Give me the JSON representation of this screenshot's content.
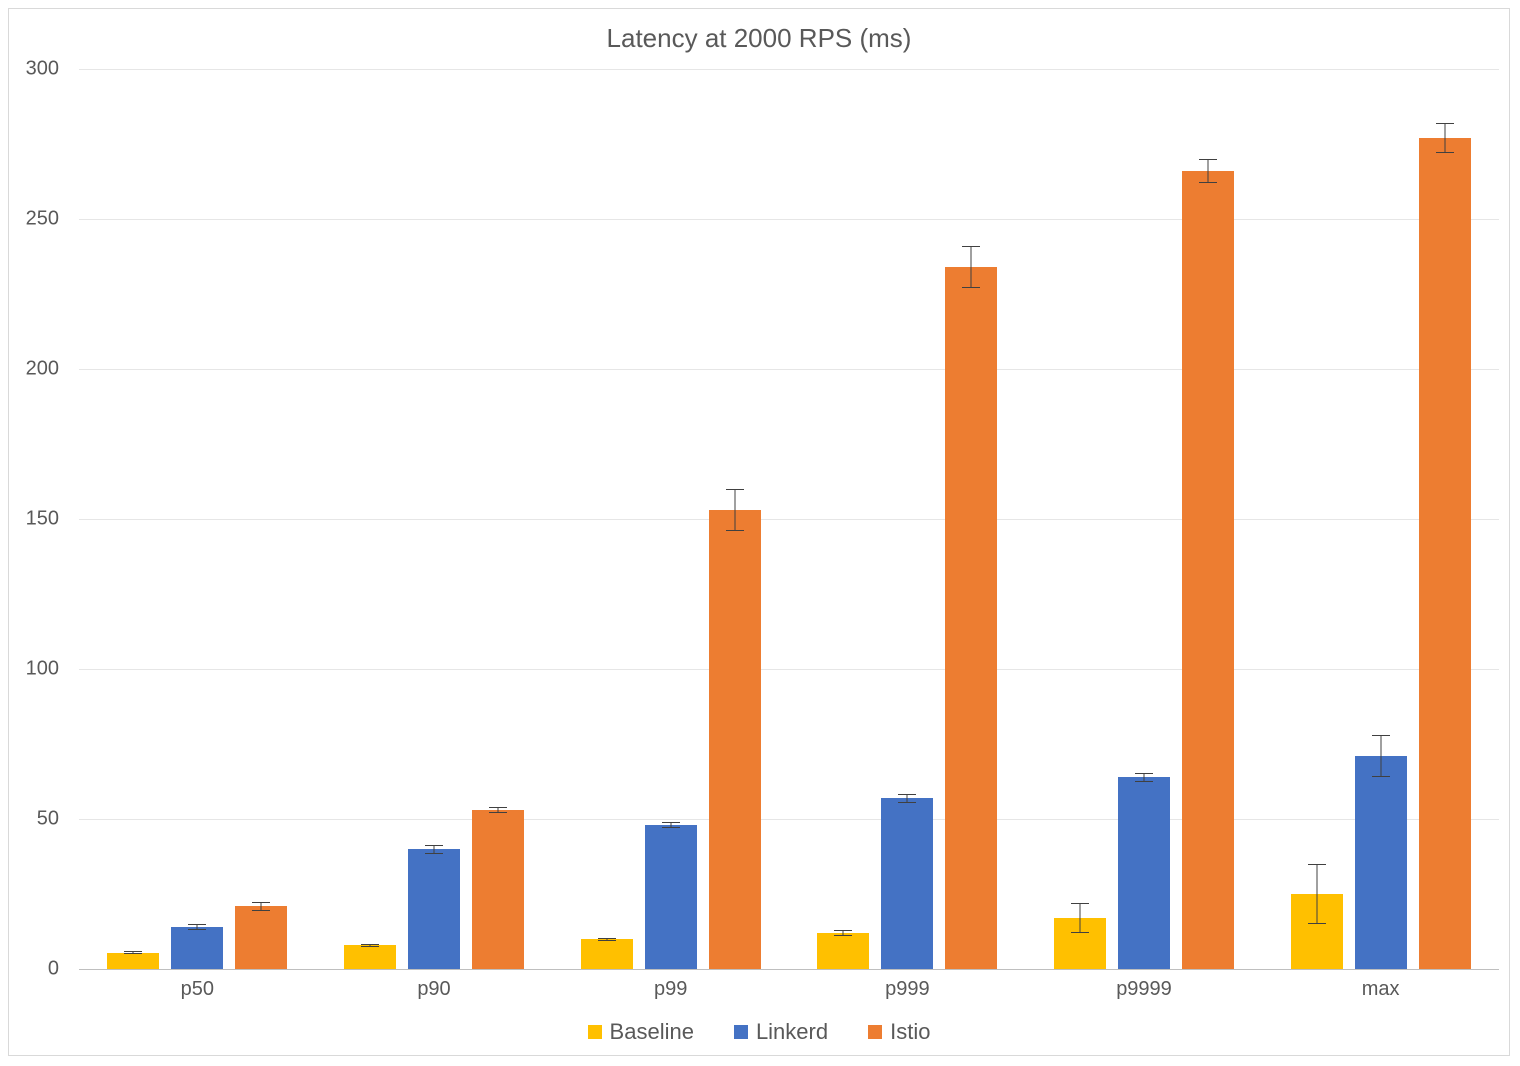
{
  "chart_data": {
    "type": "bar",
    "title": "Latency at 2000 RPS (ms)",
    "xlabel": "",
    "ylabel": "",
    "ylim": [
      0,
      300
    ],
    "yticks": [
      0,
      50,
      100,
      150,
      200,
      250,
      300
    ],
    "categories": [
      "p50",
      "p90",
      "p99",
      "p999",
      "p9999",
      "max"
    ],
    "series": [
      {
        "name": "Baseline",
        "color": "#FFC000",
        "values": [
          5.5,
          8,
          10,
          12,
          17,
          25
        ],
        "errors": [
          0.5,
          0.5,
          0.5,
          1,
          5,
          10
        ]
      },
      {
        "name": "Linkerd",
        "color": "#4472C4",
        "values": [
          14,
          40,
          48,
          57,
          64,
          71
        ],
        "errors": [
          1,
          1.5,
          1,
          1.5,
          1.5,
          7
        ]
      },
      {
        "name": "Istio",
        "color": "#ED7D31",
        "values": [
          21,
          53,
          153,
          234,
          266,
          277
        ],
        "errors": [
          1.5,
          1,
          7,
          7,
          4,
          5
        ]
      }
    ],
    "legend_position": "bottom",
    "grid": true
  }
}
